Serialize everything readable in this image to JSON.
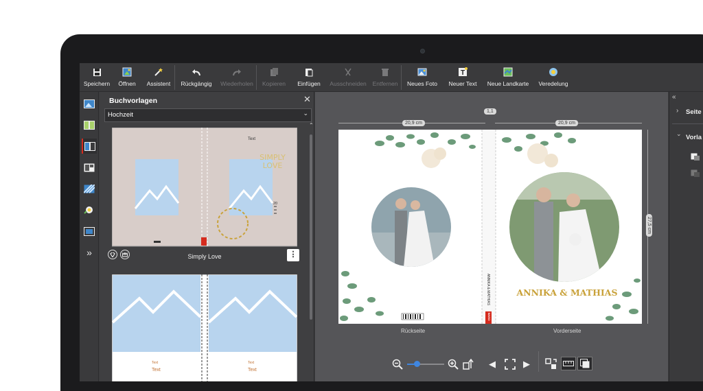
{
  "toolbar": {
    "items": [
      {
        "label": "Speichern",
        "icon": "save-icon",
        "enabled": true
      },
      {
        "label": "Öffnen",
        "icon": "open-icon",
        "enabled": true
      },
      {
        "label": "Assistent",
        "icon": "wand-icon",
        "enabled": true
      },
      {
        "label": "Rückgängig",
        "icon": "undo-icon",
        "enabled": true
      },
      {
        "label": "Wiederholen",
        "icon": "redo-icon",
        "enabled": false
      },
      {
        "label": "Kopieren",
        "icon": "copy-icon",
        "enabled": false
      },
      {
        "label": "Einfügen",
        "icon": "paste-icon",
        "enabled": true
      },
      {
        "label": "Ausschneiden",
        "icon": "cut-icon",
        "enabled": false
      },
      {
        "label": "Entfernen",
        "icon": "trash-icon",
        "enabled": false
      },
      {
        "label": "Neues Foto",
        "icon": "photo-icon",
        "enabled": true
      },
      {
        "label": "Neuer Text",
        "icon": "text-icon",
        "enabled": true
      },
      {
        "label": "Neue Landkarte",
        "icon": "map-icon",
        "enabled": true
      },
      {
        "label": "Veredelung",
        "icon": "finish-icon",
        "enabled": true
      }
    ]
  },
  "rail": {
    "items": [
      "photos-icon",
      "layouts-icon",
      "book-templates-icon",
      "page-layouts-icon",
      "backgrounds-icon",
      "cliparts-icon",
      "frames-icon",
      "more-icon"
    ],
    "active_index": 2
  },
  "panel": {
    "title": "Buchvorlagen",
    "category": "Hochzeit",
    "templates": [
      {
        "name": "Simply Love",
        "right_text": "Text",
        "title_art": "SIMPLY LOVE",
        "page_no": "20"
      },
      {
        "name": "",
        "caption_text": "Text",
        "caption_text_2": "Text"
      }
    ]
  },
  "workspace": {
    "width_left": "20,9 cm",
    "width_right": "20,9 cm",
    "spine_width": "1,1",
    "height": "27,5 cm",
    "back_label": "Rückseite",
    "front_label": "Vorderseite",
    "cover_names": "ANNIKA & MATHIAS",
    "spine_text": "ANNIKA & MATHIAS",
    "spine_logo": "CEWE"
  },
  "rpanel": {
    "section1": "Seite",
    "section2": "Vorla"
  },
  "zoom": {
    "level": 0.25
  },
  "colors": {
    "accent": "#d52b1e",
    "gold": "#c9a23a",
    "toolbar_bg": "#3a3a3c"
  }
}
